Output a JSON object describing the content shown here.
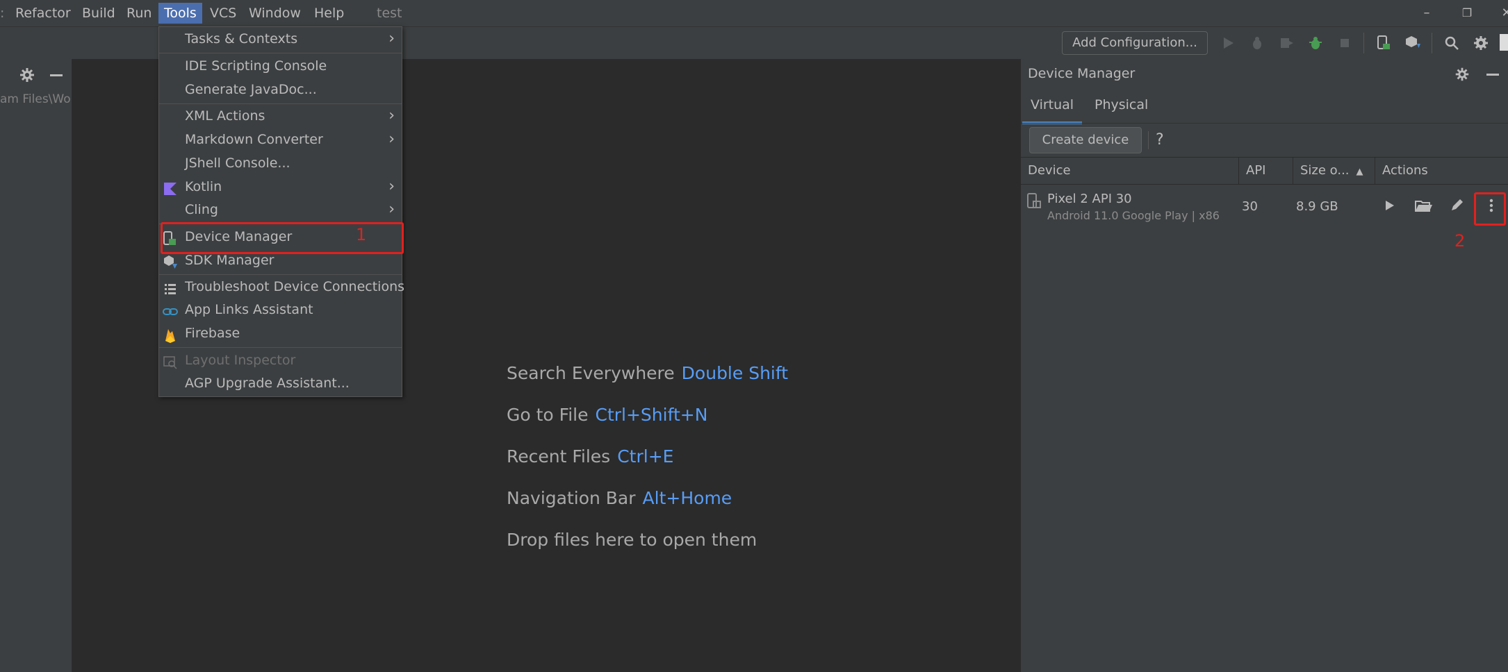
{
  "menubar": {
    "items": [
      "Refactor",
      "Build",
      "Run",
      "Tools",
      "VCS",
      "Window",
      "Help"
    ],
    "project": "test"
  },
  "toolbar": {
    "add_config_label": "Add Configuration..."
  },
  "left_panel": {
    "path_text": "am Files\\Wo"
  },
  "tools_menu": {
    "items": [
      {
        "label": "Tasks & Contexts",
        "submenu": true
      },
      {
        "label": "IDE Scripting Console"
      },
      {
        "label": "Generate JavaDoc..."
      },
      {
        "label": "XML Actions",
        "submenu": true
      },
      {
        "label": "Markdown Converter",
        "submenu": true
      },
      {
        "label": "JShell Console..."
      },
      {
        "label": "Kotlin",
        "submenu": true,
        "icon": "kotlin-icon"
      },
      {
        "label": "Cling",
        "submenu": true
      },
      {
        "label": "Device Manager",
        "icon": "device-manager-icon"
      },
      {
        "label": "SDK Manager",
        "icon": "sdk-manager-icon"
      },
      {
        "label": "Troubleshoot Device Connections",
        "icon": "list-icon"
      },
      {
        "label": "App Links Assistant",
        "icon": "link-icon"
      },
      {
        "label": "Firebase",
        "icon": "firebase-icon"
      },
      {
        "label": "Layout Inspector",
        "disabled": true,
        "icon": "layout-inspector-icon"
      },
      {
        "label": "AGP Upgrade Assistant..."
      }
    ]
  },
  "annotations": {
    "label1": "1",
    "label2": "2"
  },
  "editor_hints": [
    {
      "label": "Search Everywhere",
      "key": "Double Shift"
    },
    {
      "label": "Go to File",
      "key": "Ctrl+Shift+N"
    },
    {
      "label": "Recent Files",
      "key": "Ctrl+E"
    },
    {
      "label": "Navigation Bar",
      "key": "Alt+Home"
    },
    {
      "label": "Drop files here to open them",
      "key": ""
    }
  ],
  "device_manager": {
    "title": "Device Manager",
    "tabs": [
      "Virtual",
      "Physical"
    ],
    "create_label": "Create device",
    "help_label": "?",
    "columns": [
      "Device",
      "API",
      "Size o...",
      "Actions"
    ],
    "rows": [
      {
        "name": "Pixel 2 API 30",
        "subtitle": "Android 11.0 Google Play | x86",
        "api": "30",
        "size": "8.9 GB"
      }
    ]
  }
}
